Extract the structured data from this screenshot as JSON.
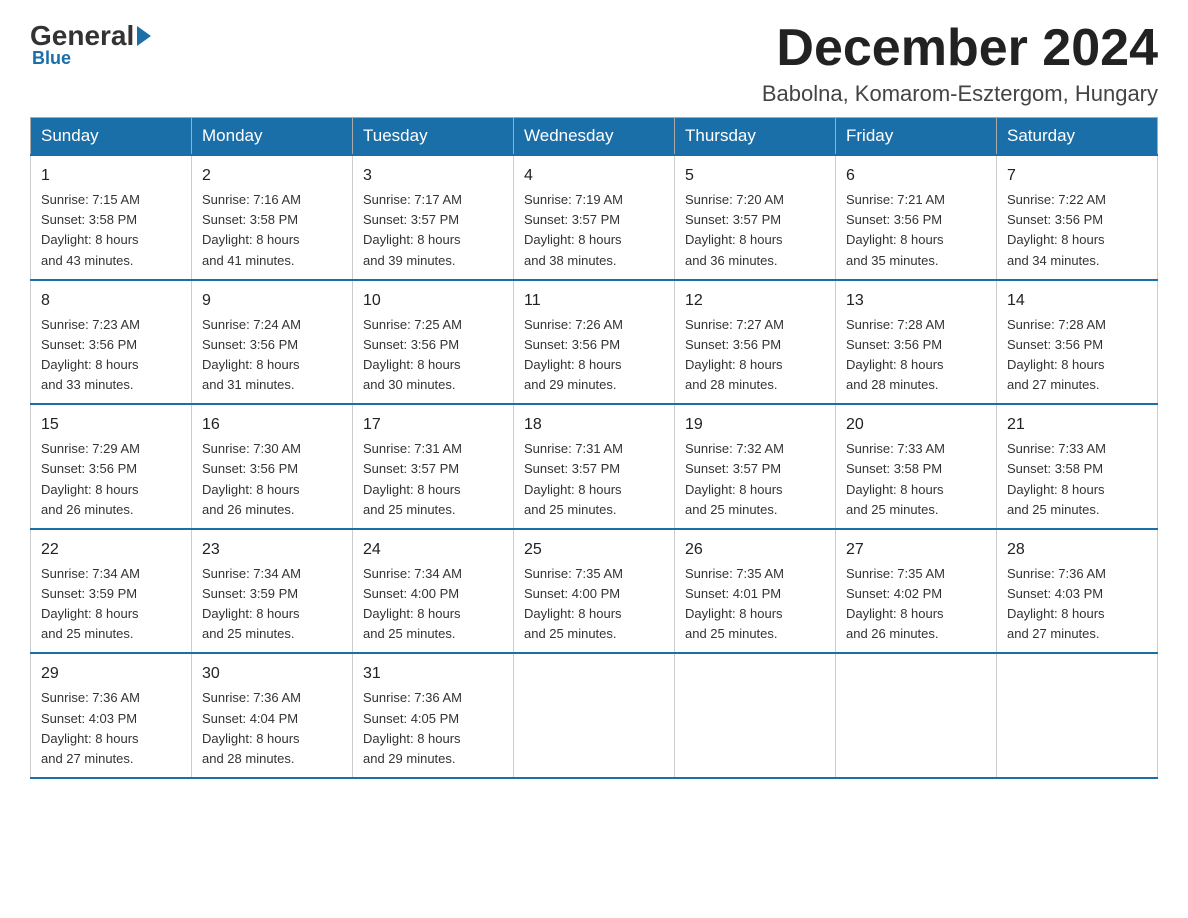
{
  "header": {
    "logo_general": "General",
    "logo_blue": "Blue",
    "month_title": "December 2024",
    "location": "Babolna, Komarom-Esztergom, Hungary"
  },
  "days_of_week": [
    "Sunday",
    "Monday",
    "Tuesday",
    "Wednesday",
    "Thursday",
    "Friday",
    "Saturday"
  ],
  "weeks": [
    [
      {
        "day": "1",
        "sunrise": "7:15 AM",
        "sunset": "3:58 PM",
        "daylight": "8 hours and 43 minutes."
      },
      {
        "day": "2",
        "sunrise": "7:16 AM",
        "sunset": "3:58 PM",
        "daylight": "8 hours and 41 minutes."
      },
      {
        "day": "3",
        "sunrise": "7:17 AM",
        "sunset": "3:57 PM",
        "daylight": "8 hours and 39 minutes."
      },
      {
        "day": "4",
        "sunrise": "7:19 AM",
        "sunset": "3:57 PM",
        "daylight": "8 hours and 38 minutes."
      },
      {
        "day": "5",
        "sunrise": "7:20 AM",
        "sunset": "3:57 PM",
        "daylight": "8 hours and 36 minutes."
      },
      {
        "day": "6",
        "sunrise": "7:21 AM",
        "sunset": "3:56 PM",
        "daylight": "8 hours and 35 minutes."
      },
      {
        "day": "7",
        "sunrise": "7:22 AM",
        "sunset": "3:56 PM",
        "daylight": "8 hours and 34 minutes."
      }
    ],
    [
      {
        "day": "8",
        "sunrise": "7:23 AM",
        "sunset": "3:56 PM",
        "daylight": "8 hours and 33 minutes."
      },
      {
        "day": "9",
        "sunrise": "7:24 AM",
        "sunset": "3:56 PM",
        "daylight": "8 hours and 31 minutes."
      },
      {
        "day": "10",
        "sunrise": "7:25 AM",
        "sunset": "3:56 PM",
        "daylight": "8 hours and 30 minutes."
      },
      {
        "day": "11",
        "sunrise": "7:26 AM",
        "sunset": "3:56 PM",
        "daylight": "8 hours and 29 minutes."
      },
      {
        "day": "12",
        "sunrise": "7:27 AM",
        "sunset": "3:56 PM",
        "daylight": "8 hours and 28 minutes."
      },
      {
        "day": "13",
        "sunrise": "7:28 AM",
        "sunset": "3:56 PM",
        "daylight": "8 hours and 28 minutes."
      },
      {
        "day": "14",
        "sunrise": "7:28 AM",
        "sunset": "3:56 PM",
        "daylight": "8 hours and 27 minutes."
      }
    ],
    [
      {
        "day": "15",
        "sunrise": "7:29 AM",
        "sunset": "3:56 PM",
        "daylight": "8 hours and 26 minutes."
      },
      {
        "day": "16",
        "sunrise": "7:30 AM",
        "sunset": "3:56 PM",
        "daylight": "8 hours and 26 minutes."
      },
      {
        "day": "17",
        "sunrise": "7:31 AM",
        "sunset": "3:57 PM",
        "daylight": "8 hours and 25 minutes."
      },
      {
        "day": "18",
        "sunrise": "7:31 AM",
        "sunset": "3:57 PM",
        "daylight": "8 hours and 25 minutes."
      },
      {
        "day": "19",
        "sunrise": "7:32 AM",
        "sunset": "3:57 PM",
        "daylight": "8 hours and 25 minutes."
      },
      {
        "day": "20",
        "sunrise": "7:33 AM",
        "sunset": "3:58 PM",
        "daylight": "8 hours and 25 minutes."
      },
      {
        "day": "21",
        "sunrise": "7:33 AM",
        "sunset": "3:58 PM",
        "daylight": "8 hours and 25 minutes."
      }
    ],
    [
      {
        "day": "22",
        "sunrise": "7:34 AM",
        "sunset": "3:59 PM",
        "daylight": "8 hours and 25 minutes."
      },
      {
        "day": "23",
        "sunrise": "7:34 AM",
        "sunset": "3:59 PM",
        "daylight": "8 hours and 25 minutes."
      },
      {
        "day": "24",
        "sunrise": "7:34 AM",
        "sunset": "4:00 PM",
        "daylight": "8 hours and 25 minutes."
      },
      {
        "day": "25",
        "sunrise": "7:35 AM",
        "sunset": "4:00 PM",
        "daylight": "8 hours and 25 minutes."
      },
      {
        "day": "26",
        "sunrise": "7:35 AM",
        "sunset": "4:01 PM",
        "daylight": "8 hours and 25 minutes."
      },
      {
        "day": "27",
        "sunrise": "7:35 AM",
        "sunset": "4:02 PM",
        "daylight": "8 hours and 26 minutes."
      },
      {
        "day": "28",
        "sunrise": "7:36 AM",
        "sunset": "4:03 PM",
        "daylight": "8 hours and 27 minutes."
      }
    ],
    [
      {
        "day": "29",
        "sunrise": "7:36 AM",
        "sunset": "4:03 PM",
        "daylight": "8 hours and 27 minutes."
      },
      {
        "day": "30",
        "sunrise": "7:36 AM",
        "sunset": "4:04 PM",
        "daylight": "8 hours and 28 minutes."
      },
      {
        "day": "31",
        "sunrise": "7:36 AM",
        "sunset": "4:05 PM",
        "daylight": "8 hours and 29 minutes."
      },
      null,
      null,
      null,
      null
    ]
  ],
  "labels": {
    "sunrise": "Sunrise:",
    "sunset": "Sunset:",
    "daylight": "Daylight:"
  }
}
